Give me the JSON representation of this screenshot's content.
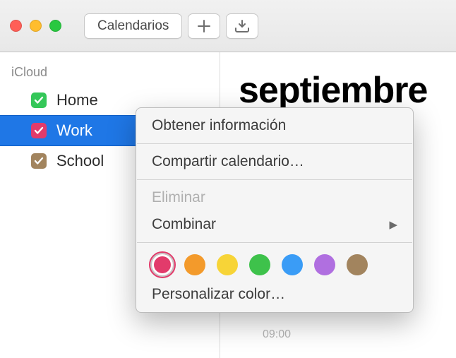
{
  "toolbar": {
    "calendars_label": "Calendarios"
  },
  "sidebar": {
    "section": "iCloud",
    "items": [
      {
        "label": "Home",
        "color": "#34c759",
        "selected": false
      },
      {
        "label": "Work",
        "color": "#e23b6b",
        "selected": true
      },
      {
        "label": "School",
        "color": "#a2845e",
        "selected": false
      }
    ]
  },
  "main": {
    "month": "septiembre",
    "time_label": "09:00"
  },
  "context_menu": {
    "get_info": "Obtener información",
    "share": "Compartir calendario…",
    "delete": "Eliminar",
    "merge": "Combinar",
    "custom_color": "Personalizar color…",
    "colors": [
      "#e23b6b",
      "#f39a2b",
      "#f7d437",
      "#3ec24b",
      "#3a9cf6",
      "#b06fe0",
      "#a2845e"
    ],
    "selected_color_index": 0
  }
}
